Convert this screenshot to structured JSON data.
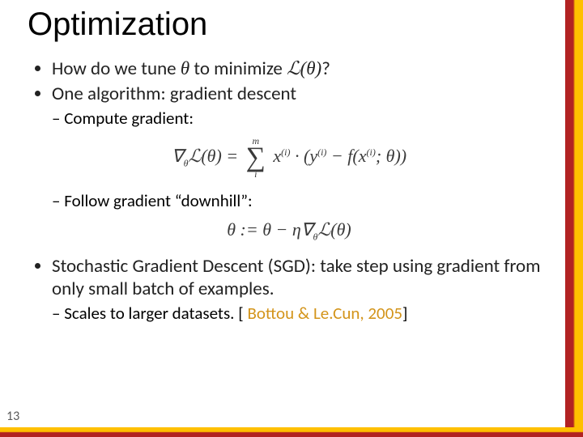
{
  "title": "Optimization",
  "bullets": {
    "tune": {
      "a": "How do we tune ",
      "theta": "θ",
      "b": " to minimize ",
      "loss": "ℒ(θ)",
      "c": "?"
    },
    "algo": "One algorithm:  gradient descent",
    "sgd": "Stochastic Gradient Descent (SGD):  take step using gradient from only small batch of examples."
  },
  "sub": {
    "compute": "Compute gradient:",
    "follow": "Follow gradient “downhill”:",
    "scales": {
      "a": "Scales to larger datasets.  [",
      "cite": "Bottou & Le.Cun, 2005",
      "b": "]"
    }
  },
  "eq1": {
    "top": "m",
    "bot": "i"
  },
  "page": "13"
}
